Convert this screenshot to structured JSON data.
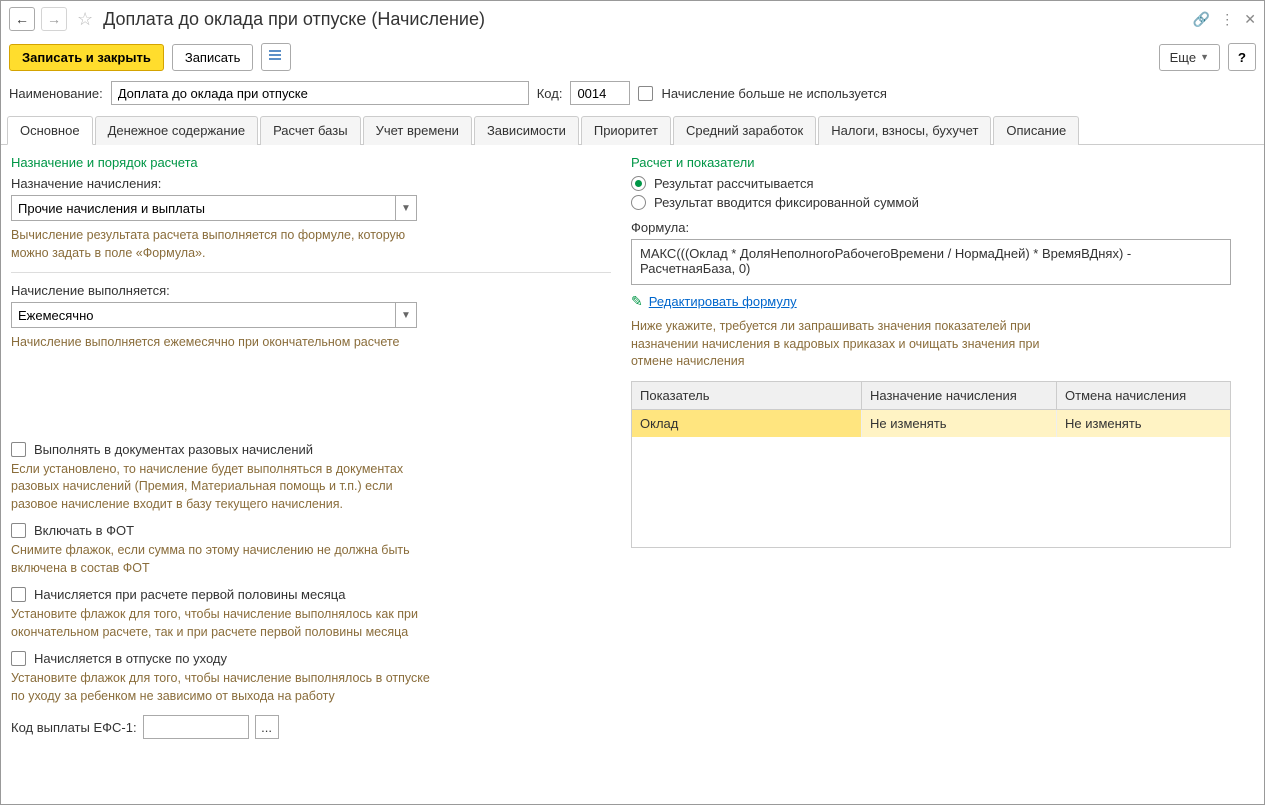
{
  "title": "Доплата до оклада при отпуске (Начисление)",
  "toolbar": {
    "save_close": "Записать и закрыть",
    "save": "Записать",
    "more": "Еще",
    "help": "?"
  },
  "form": {
    "name_label": "Наименование:",
    "name_value": "Доплата до оклада при отпуске",
    "code_label": "Код:",
    "code_value": "0014",
    "not_used_label": "Начисление больше не используется"
  },
  "tabs": [
    "Основное",
    "Денежное содержание",
    "Расчет базы",
    "Учет времени",
    "Зависимости",
    "Приоритет",
    "Средний заработок",
    "Налоги, взносы, бухучет",
    "Описание"
  ],
  "left": {
    "section1": "Назначение и порядок расчета",
    "purpose_label": "Назначение начисления:",
    "purpose_value": "Прочие начисления и выплаты",
    "purpose_hint": "Вычисление результата расчета выполняется по формуле, которую можно задать в поле «Формула».",
    "exec_label": "Начисление выполняется:",
    "exec_value": "Ежемесячно",
    "exec_hint": "Начисление выполняется ежемесячно при окончательном расчете",
    "cb1_label": "Выполнять в документах разовых начислений",
    "cb1_hint": "Если установлено, то начисление будет выполняться в документах разовых начислений (Премия, Материальная помощь и т.п.) если разовое начисление входит в базу текущего начисления.",
    "cb2_label": "Включать в ФОТ",
    "cb2_hint": "Снимите флажок, если сумма по этому начислению не должна быть включена в состав ФОТ",
    "cb3_label": "Начисляется при расчете первой половины месяца",
    "cb3_hint": "Установите флажок для того, чтобы начисление выполнялось как при окончательном расчете, так и при расчете первой половины месяца",
    "cb4_label": "Начисляется в отпуске по уходу",
    "cb4_hint": "Установите флажок для того, чтобы начисление выполнялось в отпуске по уходу за ребенком не зависимо от выхода на работу",
    "efs_label": "Код выплаты ЕФС-1:",
    "efs_btn": "..."
  },
  "right": {
    "section": "Расчет и показатели",
    "radio1": "Результат рассчитывается",
    "radio2": "Результат вводится фиксированной суммой",
    "formula_label": "Формула:",
    "formula_value": "МАКС(((Оклад * ДоляНеполногоРабочегоВремени / НормаДней) * ВремяВДнях) - РасчетнаяБаза, 0)",
    "edit_link": "Редактировать формулу",
    "hint": "Ниже укажите, требуется ли запрашивать значения показателей при назначении начисления в кадровых приказах и очищать значения при отмене начисления",
    "table": {
      "headers": [
        "Показатель",
        "Назначение начисления",
        "Отмена начисления"
      ],
      "rows": [
        [
          "Оклад",
          "Не изменять",
          "Не изменять"
        ]
      ]
    }
  }
}
